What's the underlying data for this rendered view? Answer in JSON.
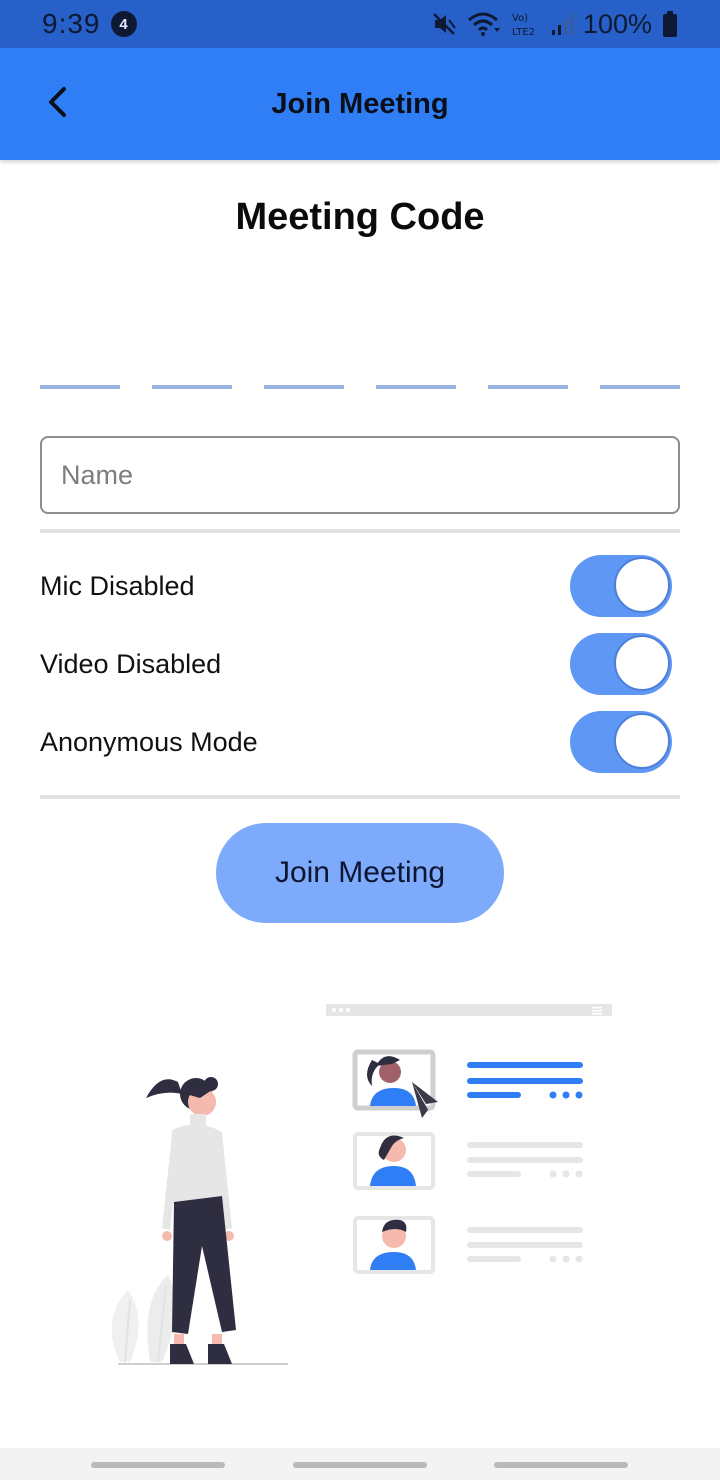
{
  "status_bar": {
    "time": "9:39",
    "notification_count": "4",
    "battery": "100%",
    "network_label": "Vo) LTE2",
    "icons": [
      "mute-icon",
      "wifi-icon",
      "signal-icon",
      "battery-icon"
    ]
  },
  "app_bar": {
    "title": "Join Meeting",
    "back_icon": "back-arrow-icon",
    "background": "#2f7ef5"
  },
  "meeting_code": {
    "title": "Meeting Code",
    "slot_count": 6,
    "value": ""
  },
  "name_field": {
    "placeholder": "Name",
    "value": ""
  },
  "toggles": [
    {
      "label": "Mic Disabled",
      "on": true
    },
    {
      "label": "Video Disabled",
      "on": true
    },
    {
      "label": "Anonymous Mode",
      "on": true
    }
  ],
  "join_button": {
    "label": "Join Meeting",
    "color": "#7eaafc"
  },
  "colors": {
    "accent": "#2f7ef5",
    "toggle_on": "#5f97f5",
    "code_underline": "#9ab4e2"
  }
}
